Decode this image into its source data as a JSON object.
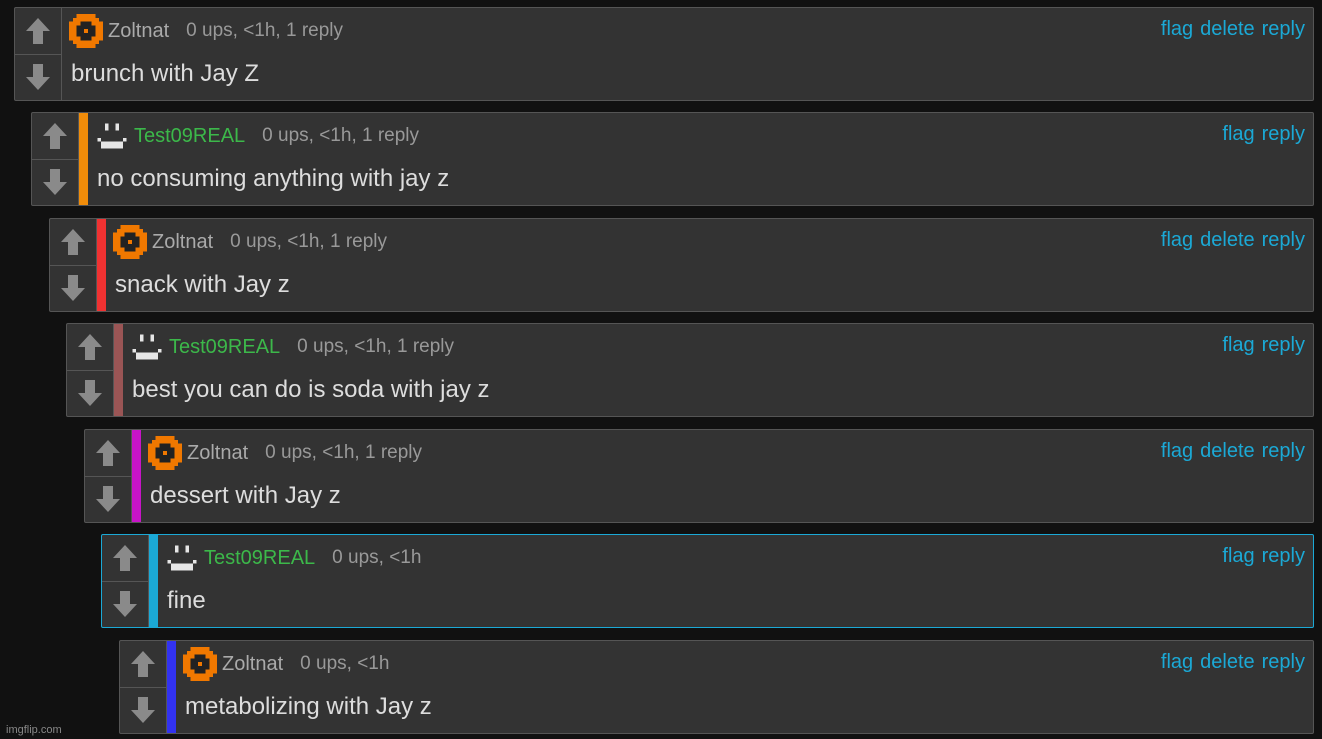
{
  "actions": {
    "flag": "flag",
    "delete": "delete",
    "reply": "reply"
  },
  "watermark": "imgflip.com",
  "colors": {
    "background": "#111111",
    "panel": "#333333",
    "link": "#1ba9d6",
    "username_green": "#3cb84a",
    "zoltnat_avatar": "#f07800"
  },
  "comments": [
    {
      "user": "Zoltnat",
      "avatar": "orange-pixel-icon",
      "stats": "0 ups, <1h, 1 reply",
      "text": "brunch with Jay Z",
      "depth_color": null,
      "can_delete": true
    },
    {
      "user": "Test09REAL",
      "avatar": "smiley-pixel-icon",
      "stats": "0 ups, <1h, 1 reply",
      "text": "no consuming anything with jay z",
      "depth_color": "#f08c0a",
      "can_delete": false
    },
    {
      "user": "Zoltnat",
      "avatar": "orange-pixel-icon",
      "stats": "0 ups, <1h, 1 reply",
      "text": "snack with Jay z",
      "depth_color": "#f03232",
      "can_delete": true
    },
    {
      "user": "Test09REAL",
      "avatar": "smiley-pixel-icon",
      "stats": "0 ups, <1h, 1 reply",
      "text": "best you can do is soda with jay z",
      "depth_color": "#9a5555",
      "can_delete": false
    },
    {
      "user": "Zoltnat",
      "avatar": "orange-pixel-icon",
      "stats": "0 ups, <1h, 1 reply",
      "text": "dessert with Jay z",
      "depth_color": "#c814c8",
      "can_delete": true
    },
    {
      "user": "Test09REAL",
      "avatar": "smiley-pixel-icon",
      "stats": "0 ups, <1h",
      "text": "fine",
      "depth_color": "#1ba9d6",
      "can_delete": false,
      "highlighted": true
    },
    {
      "user": "Zoltnat",
      "avatar": "orange-pixel-icon",
      "stats": "0 ups, <1h",
      "text": "metabolizing with Jay z",
      "depth_color": "#3232f0",
      "can_delete": true
    }
  ]
}
